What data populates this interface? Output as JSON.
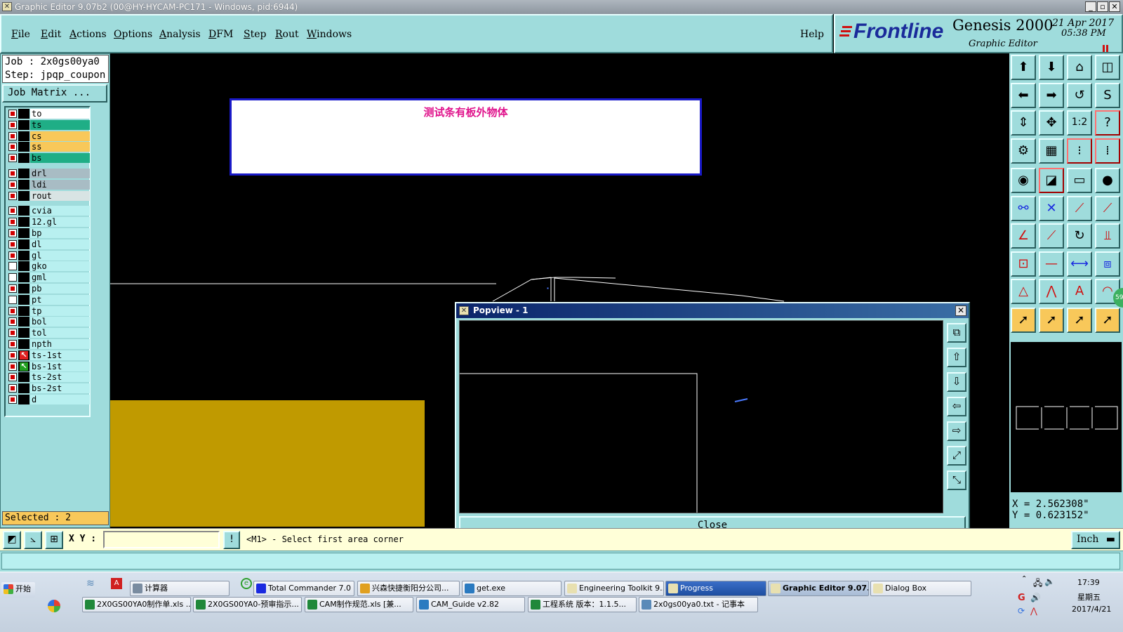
{
  "window": {
    "title": "Graphic Editor 9.07b2 (00@HY-HYCAM-PC171 - Windows, pid:6944)",
    "icon": "app-icon"
  },
  "menubar": {
    "items": [
      {
        "label": "File",
        "underline": "F",
        "rest": "ile"
      },
      {
        "label": "Edit",
        "underline": "E",
        "rest": "dit"
      },
      {
        "label": "Actions",
        "underline": "A",
        "rest": "ctions"
      },
      {
        "label": "Options",
        "underline": "O",
        "rest": "ptions"
      },
      {
        "label": "Analysis",
        "underline": "A",
        "rest": "nalysis"
      },
      {
        "label": "DFM",
        "underline": "D",
        "rest": "FM"
      },
      {
        "label": "Step",
        "underline": "S",
        "rest": "tep"
      },
      {
        "label": "Rout",
        "underline": "R",
        "rest": "out"
      },
      {
        "label": "Windows",
        "underline": "W",
        "rest": "indows"
      }
    ],
    "help": "Help"
  },
  "brand": {
    "logo_text": "Frontline",
    "product": "Genesis 2000",
    "subtitle": "Graphic Editor",
    "date": "21 Apr 2017",
    "time": "05:38 PM",
    "accent": "#1a2a9a",
    "logo_red": "#d01010"
  },
  "job": {
    "job_line": "Job : 2x0gs00ya0",
    "step_line": "Step: jpqp_coupon",
    "matrix_button": "Job Matrix ..."
  },
  "layers": [
    {
      "name": "to",
      "color": "#ffffff",
      "checked": true,
      "group": 0
    },
    {
      "name": "ts",
      "color": "#1fae86",
      "checked": true,
      "group": 0
    },
    {
      "name": "cs",
      "color": "#f8c85a",
      "checked": true,
      "group": 0
    },
    {
      "name": "ss",
      "color": "#f8c85a",
      "checked": true,
      "group": 0
    },
    {
      "name": "bs",
      "color": "#1fae86",
      "checked": true,
      "group": 0
    },
    {
      "name": "drl",
      "color": "#a8bcc4",
      "checked": true,
      "group": 1
    },
    {
      "name": "ldi",
      "color": "#a8bcc4",
      "checked": true,
      "group": 1
    },
    {
      "name": "rout",
      "color": "#d8e4e4",
      "checked": true,
      "group": 1
    },
    {
      "name": "cvia",
      "color": "#b8f0f0",
      "checked": true,
      "group": 2
    },
    {
      "name": "12.gl",
      "color": "#b8f0f0",
      "checked": true,
      "group": 2
    },
    {
      "name": "bp",
      "color": "#b8f0f0",
      "checked": true,
      "group": 2
    },
    {
      "name": "dl",
      "color": "#b8f0f0",
      "checked": true,
      "group": 2
    },
    {
      "name": "gl",
      "color": "#b8f0f0",
      "checked": true,
      "group": 2
    },
    {
      "name": "gko",
      "color": "#b8f0f0",
      "checked": false,
      "group": 2
    },
    {
      "name": "gml",
      "color": "#b8f0f0",
      "checked": false,
      "group": 2
    },
    {
      "name": "pb",
      "color": "#b8f0f0",
      "checked": true,
      "group": 2
    },
    {
      "name": "pt",
      "color": "#b8f0f0",
      "checked": false,
      "group": 2
    },
    {
      "name": "tp",
      "color": "#b8f0f0",
      "checked": true,
      "group": 2
    },
    {
      "name": "bol",
      "color": "#b8f0f0",
      "checked": true,
      "group": 2
    },
    {
      "name": "tol",
      "color": "#b8f0f0",
      "checked": true,
      "group": 2
    },
    {
      "name": "npth",
      "color": "#b8f0f0",
      "checked": true,
      "group": 2
    },
    {
      "name": "ts-1st",
      "color": "#b8f0f0",
      "checked": true,
      "group": 2,
      "marker": "red-arrow"
    },
    {
      "name": "bs-1st",
      "color": "#b8f0f0",
      "checked": true,
      "group": 2,
      "marker": "green-arrow"
    },
    {
      "name": "ts-2st",
      "color": "#b8f0f0",
      "checked": true,
      "group": 2
    },
    {
      "name": "bs-2st",
      "color": "#b8f0f0",
      "checked": true,
      "group": 2
    },
    {
      "name": "d",
      "color": "#b8f0f0",
      "checked": true,
      "group": 2
    }
  ],
  "selected_text": "Selected : 2",
  "canvas": {
    "message": "测试条有板外物体",
    "message_color": "#e0148c"
  },
  "popview": {
    "title": "Popview - 1",
    "close_label": "Close",
    "tools": [
      "popview-fit-icon",
      "popview-pan-up-icon",
      "popview-pan-down-icon",
      "popview-pan-left-icon",
      "popview-pan-right-icon",
      "popview-zoom-in-icon",
      "popview-zoom-out-icon"
    ]
  },
  "toolbox": {
    "rows": [
      [
        "pan-up-icon",
        "pan-down-icon",
        "home-icon",
        "window-icon"
      ],
      [
        "pan-left-icon",
        "pan-right-icon",
        "zoom-prev-icon",
        "redraw-icon"
      ],
      [
        "fit-vertical-icon",
        "fit-all-icon",
        "scale-1-2-icon",
        "help-icon"
      ],
      [
        "measure-icon",
        "grid-icon",
        "net-icon",
        "snap-icon"
      ],
      [
        "select-pad-icon",
        "highlight-icon",
        "ruler-icon",
        "circle-icon"
      ],
      [
        "connect-icon",
        "cross-icon",
        "add-line-icon",
        "extend-line-icon"
      ],
      [
        "angle-icon",
        "line-edit-icon",
        "rotate-icon",
        "mirror-text-icon"
      ],
      [
        "pad-add-icon",
        "line-delete-icon",
        "dimension-icon",
        "pattern-icon"
      ],
      [
        "warn-triangle-icon",
        "arrow-triangle-icon",
        "letter-a-icon",
        "shape-arc-icon"
      ],
      [
        "pointer-icon",
        "pointer-add-icon",
        "pointer-circle-icon",
        "pointer-move-icon"
      ]
    ],
    "badge": "59"
  },
  "coords": {
    "x": "X = 2.562308\"",
    "y": "Y = 0.623152\""
  },
  "command": {
    "xy_label": "X Y :",
    "xy_value": "",
    "prompt": "<M1> - Select first area corner",
    "unit": "Inch"
  },
  "taskbar": {
    "start": "开始",
    "row1": [
      {
        "label": "计算器",
        "icon": "calculator-icon"
      },
      {
        "label": "Total Commander 7.0 ...",
        "icon": "floppy-icon"
      },
      {
        "label": "兴森快捷衡阳分公司...",
        "icon": "star-icon"
      },
      {
        "label": "get.exe",
        "icon": "exe-icon"
      },
      {
        "label": "Engineering Toolkit 9....",
        "icon": "app-icon"
      },
      {
        "label": "Progress",
        "icon": "app-icon",
        "state": "selected"
      },
      {
        "label": "Graphic Editor 9.07...",
        "icon": "app-icon",
        "state": "active"
      },
      {
        "label": "Dialog Box",
        "icon": "app-icon"
      }
    ],
    "row2": [
      {
        "label": "2X0GS00YA0制作单.xls ...",
        "icon": "excel-icon"
      },
      {
        "label": "2X0GS00YA0-预审指示...",
        "icon": "excel-icon"
      },
      {
        "label": "CAM制作规范.xls [兼...",
        "icon": "excel-icon"
      },
      {
        "label": "CAM_Guide v2.82",
        "icon": "guide-icon"
      },
      {
        "label": "工程系统  版本：1.1.5...",
        "icon": "p-icon"
      },
      {
        "label": "2x0gs00ya0.txt - 记事本",
        "icon": "notepad-icon"
      }
    ],
    "clock_time": "17:39",
    "clock_day": "星期五",
    "clock_date": "2017/4/21"
  }
}
